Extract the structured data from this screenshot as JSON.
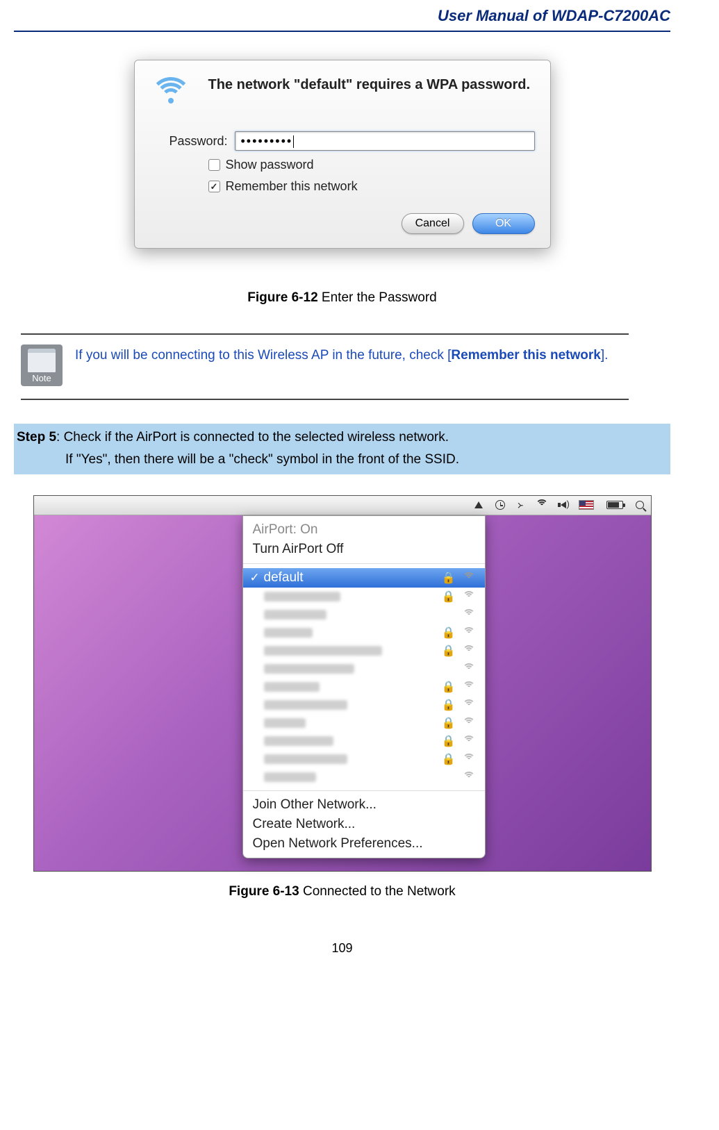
{
  "header": {
    "title": "User Manual of WDAP-C7200AC"
  },
  "dialog": {
    "message": "The network \"default\" requires a WPA password.",
    "password_label": "Password:",
    "password_value": "•••••••••",
    "show_password_checked": false,
    "show_password_label": "Show password",
    "remember_checked": true,
    "remember_label": "Remember this network",
    "cancel": "Cancel",
    "ok": "OK"
  },
  "figure1": {
    "num": "Figure 6-12",
    "caption": " Enter the Password"
  },
  "note": {
    "label": "Note",
    "text_prefix": "If you will be connecting to this Wireless AP in the future, check [",
    "text_bold": "Remember this network",
    "text_suffix": "]."
  },
  "step": {
    "num": "Step 5",
    "line1": ": Check if the AirPort is connected to the selected wireless network.",
    "line2": "If \"Yes\", then there will be a \"check\" symbol in the front of the SSID."
  },
  "menu": {
    "airport_status": "AirPort: On",
    "airport_toggle": "Turn AirPort Off",
    "selected_network": "default",
    "other_networks_count": 11,
    "join_other": "Join Other Network...",
    "create": "Create Network...",
    "open_prefs": "Open Network Preferences..."
  },
  "figure2": {
    "num": "Figure 6-13",
    "caption": " Connected to the Network"
  },
  "page_number": "109"
}
